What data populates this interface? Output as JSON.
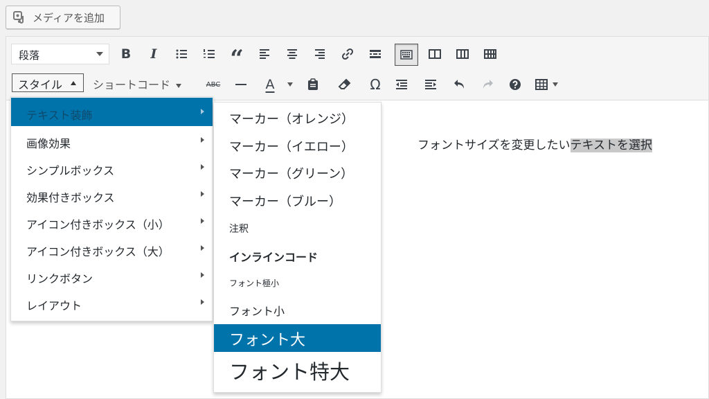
{
  "media_button": {
    "label": "メディアを追加",
    "icon": "media-icon"
  },
  "toolbar": {
    "format_select": "段落",
    "row1_icons": [
      "bold-icon",
      "italic-icon",
      "bullet-list-icon",
      "numbered-list-icon",
      "blockquote-icon",
      "align-left-icon",
      "align-center-icon",
      "align-right-icon",
      "link-icon",
      "read-more-icon",
      "toolbar-toggle-icon",
      "two-column-icon",
      "three-column-icon",
      "four-column-icon"
    ],
    "bold": "B",
    "italic": "I",
    "quote": "“",
    "style_label": "スタイル",
    "shortcode_label": "ショートコード",
    "strike": "ABC",
    "text_color": "A",
    "omega": "Ω"
  },
  "style_menu": {
    "items": [
      {
        "label": "テキスト装飾",
        "selected": true
      },
      {
        "label": "画像効果"
      },
      {
        "label": "シンプルボックス"
      },
      {
        "label": "効果付きボックス"
      },
      {
        "label": "アイコン付きボックス（小）"
      },
      {
        "label": "アイコン付きボックス（大）"
      },
      {
        "label": "リンクボタン"
      },
      {
        "label": "レイアウト"
      }
    ]
  },
  "text_decoration_menu": {
    "items": [
      {
        "label": "マーカー（オレンジ）"
      },
      {
        "label": "マーカー（イエロー）"
      },
      {
        "label": "マーカー（グリーン）"
      },
      {
        "label": "マーカー（ブルー）"
      },
      {
        "label": "注釈"
      },
      {
        "label": "インラインコード"
      },
      {
        "label": "フォント極小"
      },
      {
        "label": "フォント小"
      },
      {
        "label": "フォント大",
        "selected": true
      },
      {
        "label": "フォント特大"
      }
    ]
  },
  "content": {
    "text_plain": "フォントサイズを変更したい",
    "text_selected": "テキストを選択"
  },
  "colors": {
    "accent": "#0073aa"
  }
}
